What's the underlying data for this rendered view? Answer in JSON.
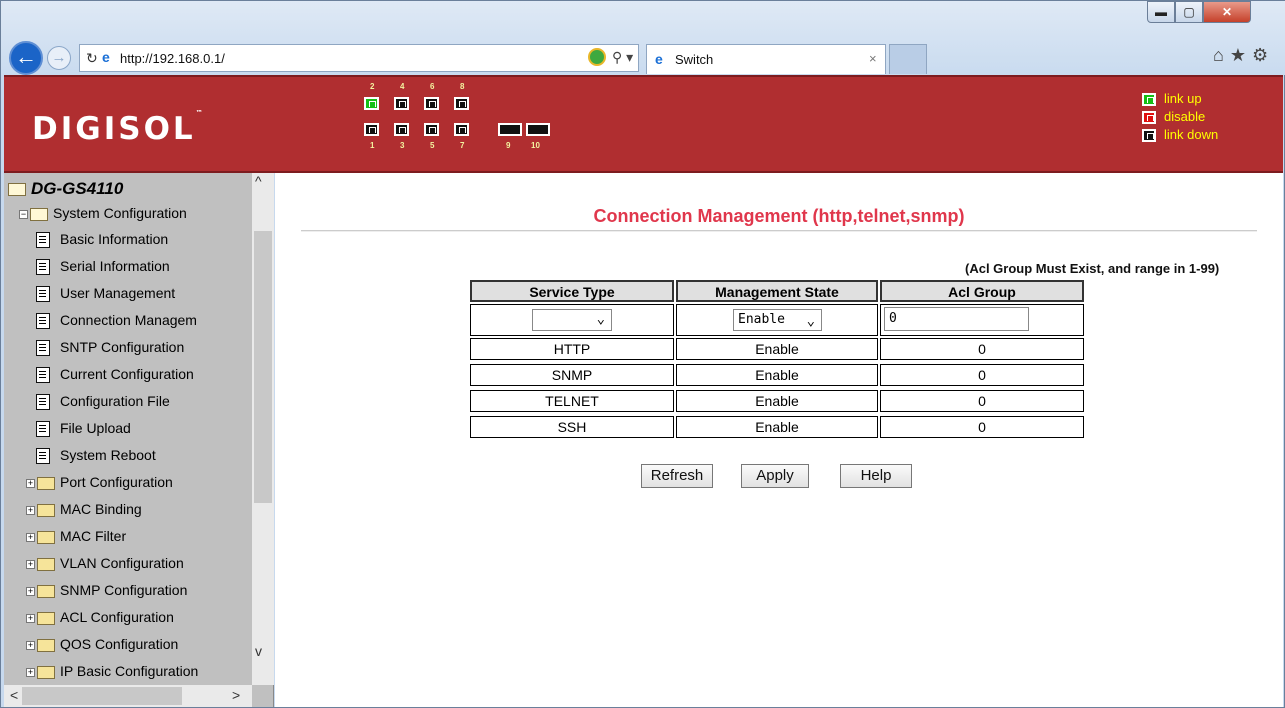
{
  "browser": {
    "url": "http://192.168.0.1/",
    "tab_title": "Switch",
    "tab_close": "×"
  },
  "header": {
    "logo": "DIGISOL",
    "logo_tm": "™",
    "port_top_numbers": [
      "2",
      "4",
      "6",
      "8"
    ],
    "port_bottom_numbers": [
      "1",
      "3",
      "5",
      "7"
    ],
    "sfp_numbers": [
      "9",
      "10"
    ],
    "port_status": {
      "2": "up",
      "4": "down",
      "6": "down",
      "8": "down",
      "1": "down",
      "3": "down",
      "5": "down",
      "7": "down",
      "9": "down",
      "10": "down"
    },
    "legend": [
      {
        "status": "up",
        "label": "link up"
      },
      {
        "status": "disable",
        "label": "disable"
      },
      {
        "status": "down",
        "label": "link down"
      }
    ],
    "colors": {
      "banner": "#b02e30",
      "link_up": "#16c016",
      "disable": "#e01010",
      "link_down": "#111111",
      "legend_text": "#ffff00"
    }
  },
  "sidebar": {
    "root": "DG-GS4110",
    "system_configuration": "System Configuration",
    "children": [
      "Basic Information",
      "Serial Information",
      "User Management",
      "Connection Managem",
      "SNTP Configuration",
      "Current Configuration",
      "Configuration File",
      "File Upload",
      "System Reboot"
    ],
    "folders": [
      "Port Configuration",
      "MAC Binding",
      "MAC Filter",
      "VLAN Configuration",
      "SNMP Configuration",
      "ACL Configuration",
      "QOS Configuration",
      "IP Basic Configuration"
    ]
  },
  "main": {
    "title": "Connection Management (http,telnet,snmp)",
    "note": "(Acl Group Must Exist, and range in 1-99)",
    "columns": [
      "Service Type",
      "Management State",
      "Acl Group"
    ],
    "form": {
      "service_type": "",
      "management_state": "Enable",
      "acl_group": "0"
    },
    "rows": [
      {
        "service": "HTTP",
        "state": "Enable",
        "acl": "0"
      },
      {
        "service": "SNMP",
        "state": "Enable",
        "acl": "0"
      },
      {
        "service": "TELNET",
        "state": "Enable",
        "acl": "0"
      },
      {
        "service": "SSH",
        "state": "Enable",
        "acl": "0"
      }
    ],
    "buttons": {
      "refresh": "Refresh",
      "apply": "Apply",
      "help": "Help"
    }
  }
}
